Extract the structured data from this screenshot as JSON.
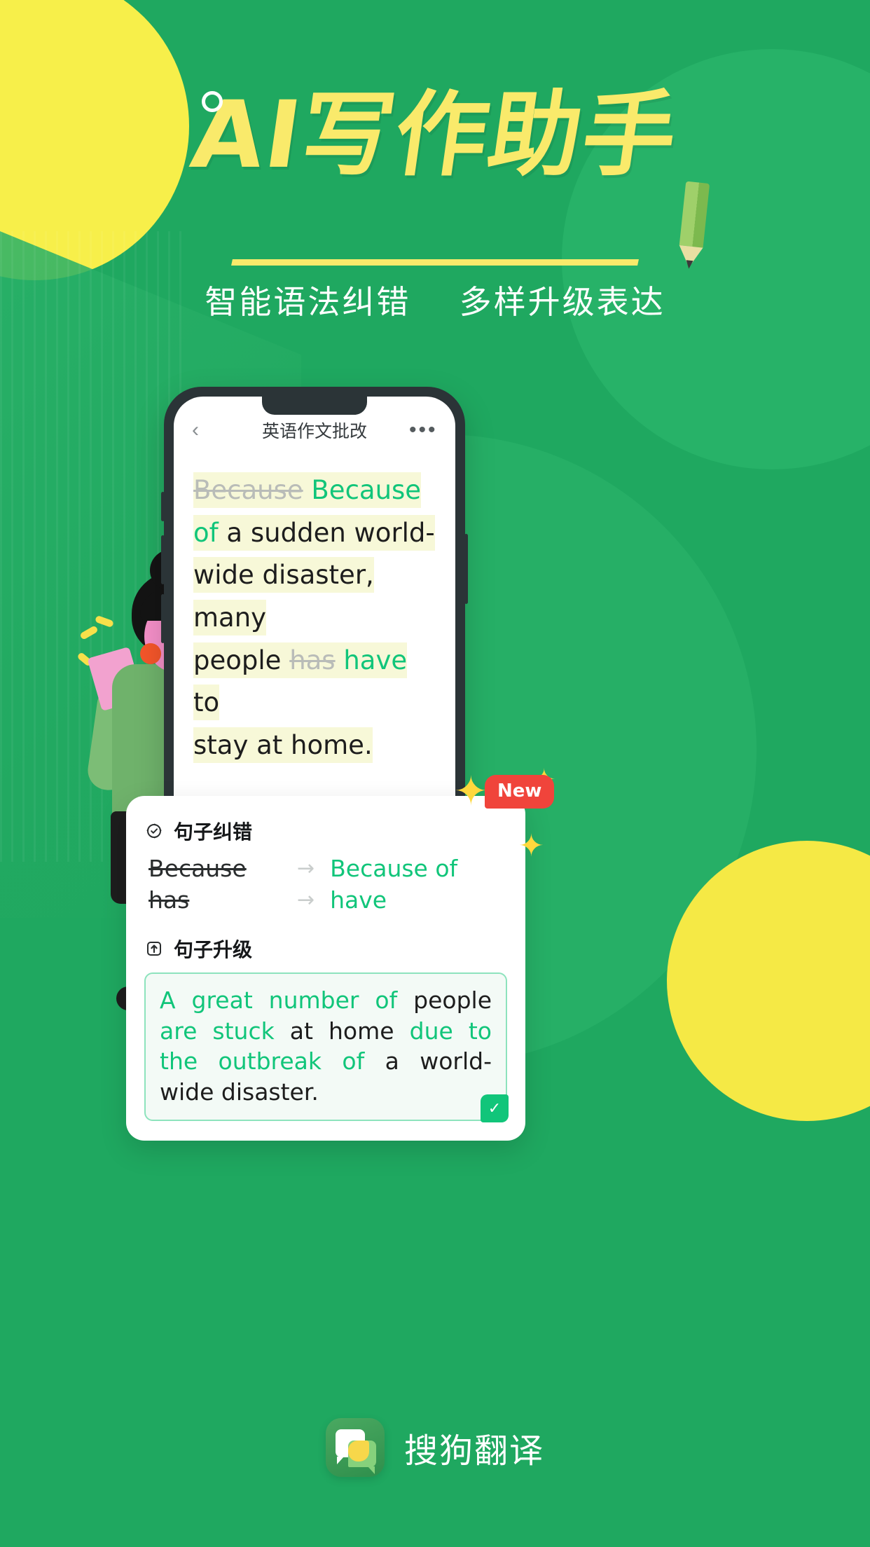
{
  "poster": {
    "headline": "AI写作助手",
    "subtitle_left": "智能语法纠错",
    "subtitle_right": "多样升级表达",
    "accent_yellow": "#f9ea6b",
    "accent_green": "#11c57a",
    "background_green": "#1fa860",
    "badge_red": "#f0443b"
  },
  "phone": {
    "nav": {
      "back_icon": "chevron-left-icon",
      "title": "英语作文批改",
      "more_icon": "more-horizontal-icon"
    },
    "essay": {
      "lines": [
        {
          "strike": "Because",
          "fix": "Because",
          "plain": ""
        },
        {
          "fix": "of",
          "plain": " a sudden world-"
        },
        {
          "plain": "wide disaster, many"
        },
        {
          "plain": "people ",
          "strike": "has",
          "fix": "have",
          "tail": " to"
        },
        {
          "plain": "stay at home."
        }
      ],
      "full_text": "Because Because of a sudden world-wide disaster, many people has have to stay at home."
    }
  },
  "result_card": {
    "correction": {
      "icon": "check-circle-icon",
      "title": "句子纠错",
      "rows": [
        {
          "old": "Because",
          "arrow": "→",
          "new": "Because of"
        },
        {
          "old": "has",
          "arrow": "→",
          "new": "have"
        }
      ]
    },
    "upgrade": {
      "icon": "arrow-up-box-icon",
      "title": "句子升级",
      "sentence": {
        "p1_green": "A great number of ",
        "p2_black": "people ",
        "p3_green": "are stuck ",
        "p4_black": "at home ",
        "p5_green": "due to the outbreak of ",
        "p6_black": "a world-wide disaster."
      },
      "confirm_icon": "✓"
    }
  },
  "badge": {
    "label": "New"
  },
  "brand": {
    "name": "搜狗翻译",
    "icon": "sogou-translate-icon"
  }
}
